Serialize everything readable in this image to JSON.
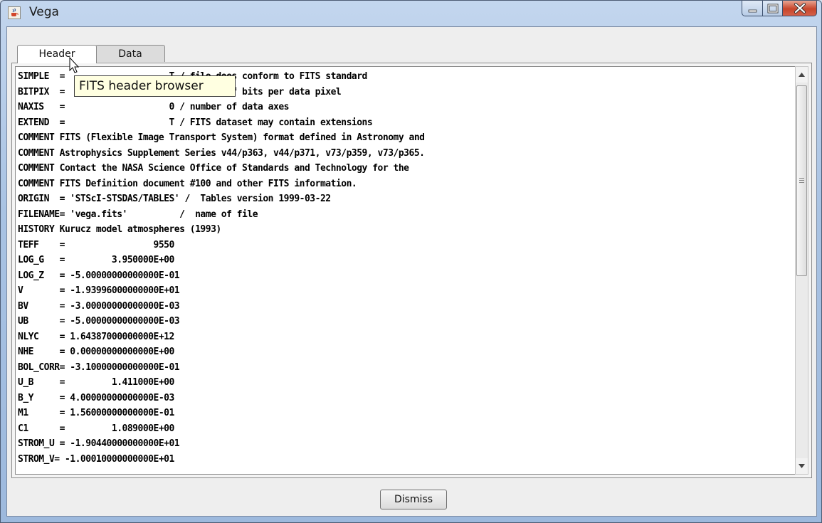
{
  "window": {
    "title": "Vega",
    "app_icon": "java-cup-icon",
    "controls": [
      "minimize-icon",
      "maximize-icon",
      "close-icon"
    ]
  },
  "tabs": [
    {
      "label": "Header",
      "active": true
    },
    {
      "label": "Data",
      "active": false
    }
  ],
  "tooltip": "FITS header browser",
  "header_lines": [
    "SIMPLE  =                    T / file does conform to FITS standard",
    "BITPIX  =                    8 / number of bits per data pixel",
    "NAXIS   =                    0 / number of data axes",
    "EXTEND  =                    T / FITS dataset may contain extensions",
    "COMMENT FITS (Flexible Image Transport System) format defined in Astronomy and",
    "COMMENT Astrophysics Supplement Series v44/p363, v44/p371, v73/p359, v73/p365.",
    "COMMENT Contact the NASA Science Office of Standards and Technology for the",
    "COMMENT FITS Definition document #100 and other FITS information.",
    "ORIGIN  = 'STScI-STSDAS/TABLES' /  Tables version 1999-03-22",
    "FILENAME= 'vega.fits'          /  name of file",
    "HISTORY Kurucz model atmospheres (1993)",
    "TEFF    =                 9550",
    "LOG_G   =         3.950000E+00",
    "LOG_Z   = -5.00000000000000E-01",
    "V       = -1.93996000000000E+01",
    "BV      = -3.00000000000000E-03",
    "UB      = -5.00000000000000E-03",
    "NLYC    = 1.64387000000000E+12",
    "NHE     = 0.00000000000000E+00",
    "BOL_CORR= -3.10000000000000E-01",
    "U_B     =         1.411000E+00",
    "B_Y     = 4.00000000000000E-03",
    "M1      = 1.56000000000000E-01",
    "C1      =         1.089000E+00",
    "STROM_U = -1.90440000000000E+01",
    "STROM_V= -1.00010000000000E+01"
  ],
  "footer": {
    "dismiss_label": "Dismiss"
  }
}
